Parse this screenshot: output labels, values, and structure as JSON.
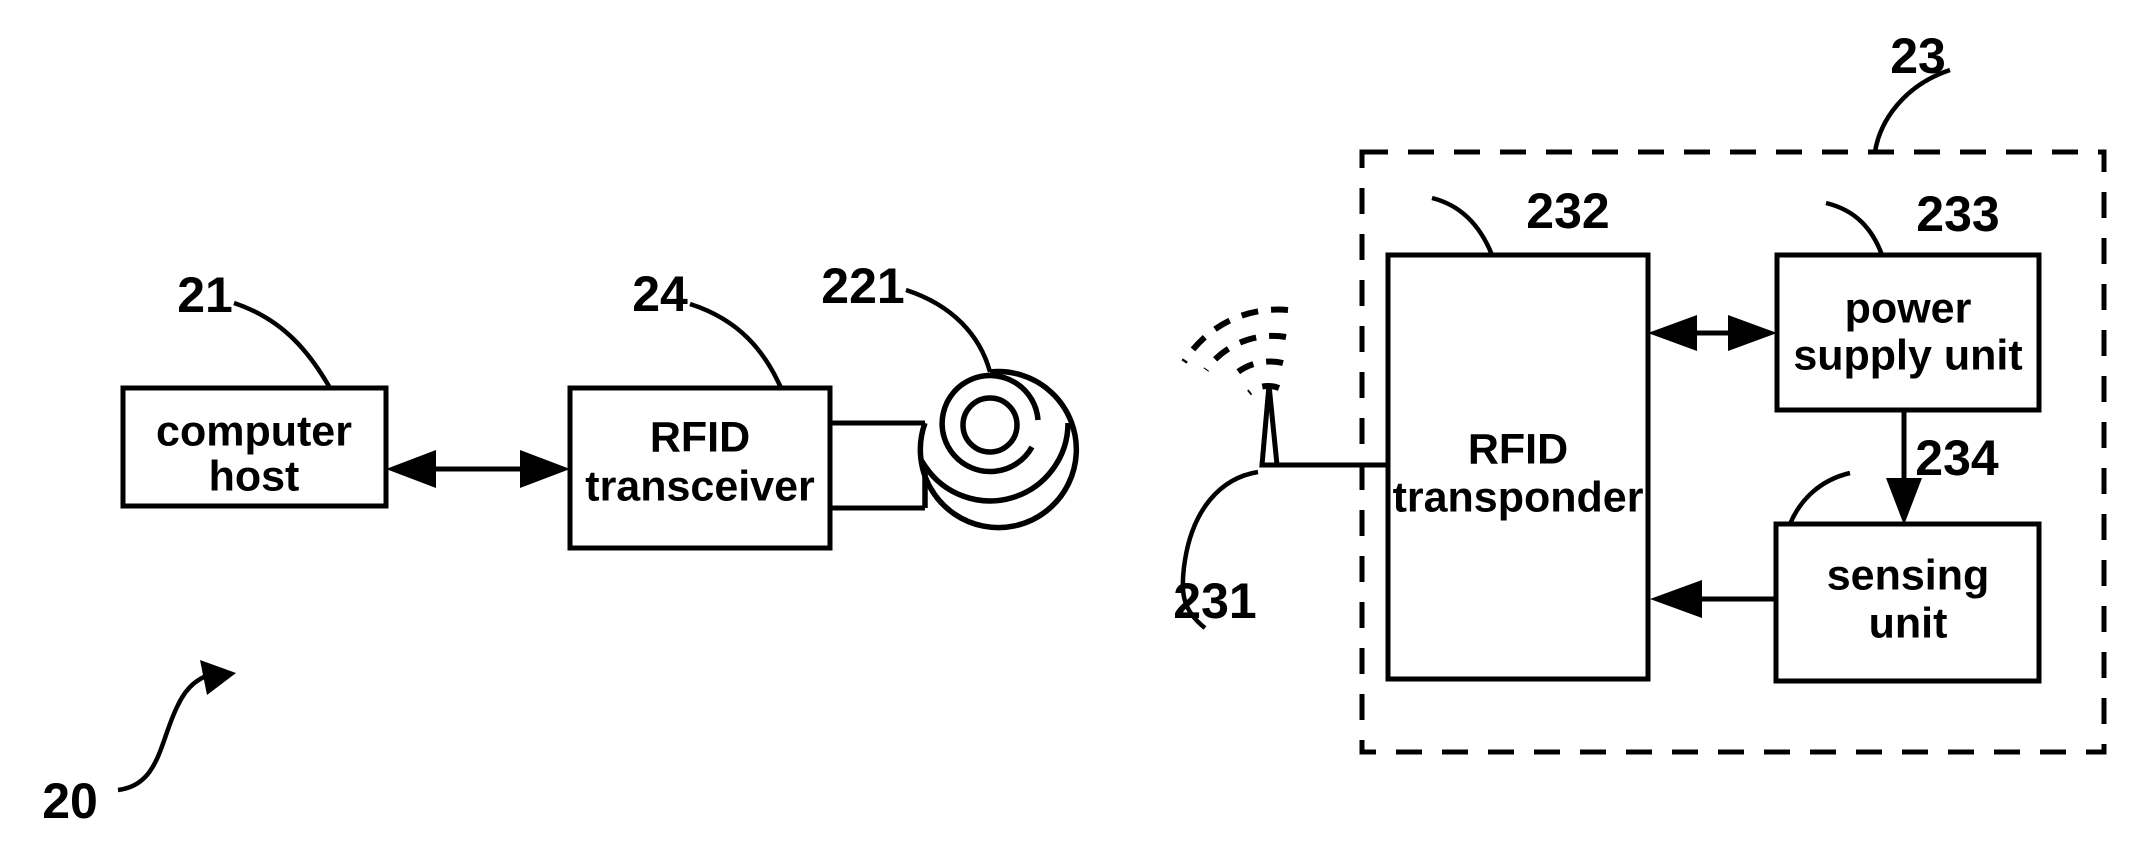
{
  "figure": {
    "type": "patent-block-diagram",
    "background_color": "#ffffff",
    "line_color": "#000000",
    "system_ref": "20"
  },
  "reference_numerals": {
    "system": "20",
    "computer_host": "21",
    "rfid_transceiver": "24",
    "transceiver_antenna_coil": "221",
    "tag_enclosure": "23",
    "tag_antenna": "231",
    "rfid_transponder": "232",
    "power_supply_unit": "233",
    "sensing_unit": "234"
  },
  "blocks": {
    "computer_host": {
      "label_line1": "computer",
      "label_line2": "host",
      "ref": "21"
    },
    "rfid_transceiver": {
      "label_line1": "RFID",
      "label_line2": "transceiver",
      "ref": "24"
    },
    "rfid_transponder": {
      "label_line1": "RFID",
      "label_line2": "transponder",
      "ref": "232"
    },
    "power_supply_unit": {
      "label_line1": "power",
      "label_line2": "supply unit",
      "ref": "233"
    },
    "sensing_unit": {
      "label_line1": "sensing",
      "label_line2": "unit",
      "ref": "234"
    }
  },
  "components": {
    "antenna_coil": {
      "name": "spiral antenna coil",
      "ref": "221"
    },
    "tag_antenna": {
      "name": "tag antenna with radiating waves",
      "ref": "231"
    },
    "tag_enclosure": {
      "name": "RFID tag dashed boundary",
      "ref": "23"
    }
  },
  "connections": [
    {
      "from": "computer_host",
      "to": "rfid_transceiver",
      "style": "double-arrow"
    },
    {
      "from": "rfid_transceiver",
      "to": "antenna_coil",
      "style": "two-wire"
    },
    {
      "from": "tag_antenna",
      "to": "rfid_transponder",
      "style": "wire"
    },
    {
      "from": "rfid_transponder",
      "to": "power_supply_unit",
      "style": "double-arrow"
    },
    {
      "from": "power_supply_unit",
      "to": "sensing_unit",
      "style": "single-arrow-down"
    },
    {
      "from": "sensing_unit",
      "to": "rfid_transponder",
      "style": "single-arrow-left"
    }
  ]
}
